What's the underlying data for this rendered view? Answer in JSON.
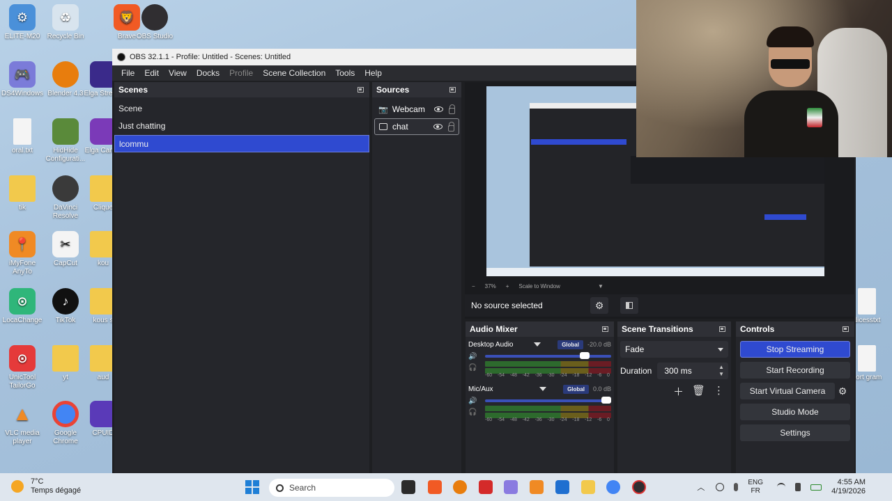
{
  "desktop": {
    "icons": [
      {
        "label": "ELITE-M20",
        "color": "#4a90d9"
      },
      {
        "label": "Recycle Bin",
        "color": "#d8e4ee"
      },
      {
        "label": "Brave",
        "color": "#f15a24"
      },
      {
        "label": "OBS Studio",
        "color": "#302e31"
      },
      {
        "label": "DS4Windows",
        "color": "#7b7bd9"
      },
      {
        "label": "Blender 4.3",
        "color": "#e87d0d"
      },
      {
        "label": "Elga Stream",
        "color": "#3a2a8a"
      },
      {
        "label": "oral.txt",
        "color": "#f4f4f4"
      },
      {
        "label": "HidHide Configurati...",
        "color": "#5a8a3a"
      },
      {
        "label": "Elga Camer",
        "color": "#7b3ab8"
      },
      {
        "label": "tik",
        "color": "#f2c94c"
      },
      {
        "label": "DaVinci Resolve",
        "color": "#3a3a3a"
      },
      {
        "label": "Clique",
        "color": "#f2c94c"
      },
      {
        "label": "iMyFone AnyTo",
        "color": "#f08a24"
      },
      {
        "label": "CapCut",
        "color": "#f4f4f4"
      },
      {
        "label": "kou",
        "color": "#f2c94c"
      },
      {
        "label": "LocaChange",
        "color": "#2fb67a"
      },
      {
        "label": "TikTok",
        "color": "#111111"
      },
      {
        "label": "kous s",
        "color": "#f2c94c"
      },
      {
        "label": "UnicTool TailorGo",
        "color": "#e53a3a"
      },
      {
        "label": "yt",
        "color": "#f2c94c"
      },
      {
        "label": "aud",
        "color": "#f2c94c"
      },
      {
        "label": "VLC media player",
        "color": "#f08a24"
      },
      {
        "label": "Google Chrome",
        "color": "#4285f4"
      },
      {
        "label": "CPUID",
        "color": "#5a3ab8"
      },
      {
        "label": "dicesstxt",
        "color": "#f4f4f4"
      },
      {
        "label": "port gram",
        "color": "#f4f4f4"
      }
    ]
  },
  "window": {
    "title": "OBS 32.1.1 - Profile: Untitled - Scenes: Untitled"
  },
  "menu": [
    "File",
    "Edit",
    "View",
    "Docks",
    "Profile",
    "Scene Collection",
    "Tools",
    "Help"
  ],
  "scenes": {
    "title": "Scenes",
    "items": [
      "Scene",
      "Just chatting",
      "lcommu"
    ],
    "selected": "lcommu"
  },
  "sources": {
    "title": "Sources",
    "items": [
      {
        "label": "Webcam",
        "icon": "camera-icon"
      },
      {
        "label": "chat",
        "icon": "monitor-icon"
      }
    ]
  },
  "preview": {
    "zoom": "37%",
    "scale_mode": "Scale to Window"
  },
  "properties_bar": {
    "no_source": "No source selected"
  },
  "mixer": {
    "title": "Audio Mixer",
    "global_label": "Global",
    "ticks": [
      "-60",
      "-54",
      "-48",
      "-42",
      "-36",
      "-30",
      "-24",
      "-18",
      "-12",
      "-6",
      "0"
    ],
    "channels": [
      {
        "name": "Desktop Audio",
        "db": "-20.0 dB",
        "volume": 0.83
      },
      {
        "name": "Mic/Aux",
        "db": "0.0 dB",
        "volume": 1.0
      }
    ]
  },
  "transitions": {
    "title": "Scene Transitions",
    "selected": "Fade",
    "duration_label": "Duration",
    "duration_value": "300 ms"
  },
  "controls": {
    "title": "Controls",
    "stop_streaming": "Stop Streaming",
    "start_recording": "Start Recording",
    "start_virtual_camera": "Start Virtual Camera",
    "studio_mode": "Studio Mode",
    "settings": "Settings"
  },
  "taskbar": {
    "temperature": "7°C",
    "weather": "Temps dégagé",
    "search_placeholder": "Search",
    "lang_top": "ENG",
    "lang_bottom": "FR",
    "time": "4:55 AM",
    "date": "4/19/2026"
  }
}
